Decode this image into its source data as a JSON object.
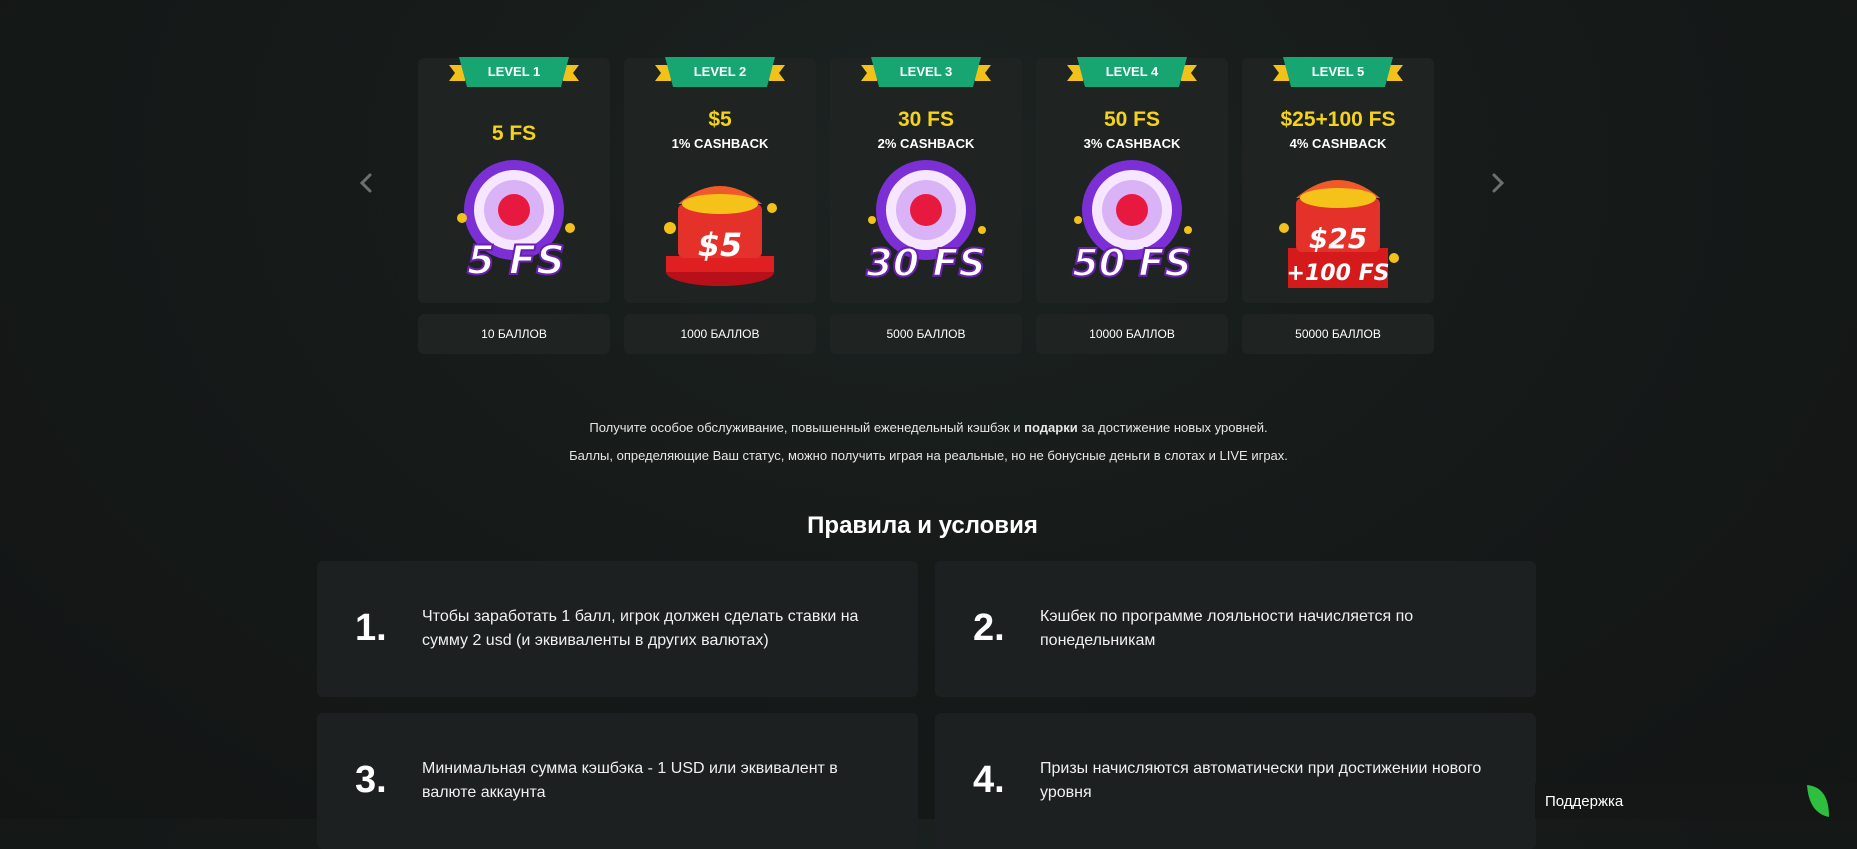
{
  "carousel": {
    "levels": [
      {
        "label": "LEVEL 1",
        "reward": "5 FS",
        "cashback": "",
        "art_text": "5 FS",
        "art": "fortune-wheel-5fs",
        "points": "10 БАЛЛОВ"
      },
      {
        "label": "LEVEL 2",
        "reward": "$5",
        "cashback": "1% CASHBACK",
        "art_text": "$5",
        "art": "treasure-chest-5",
        "points": "1000 БАЛЛОВ"
      },
      {
        "label": "LEVEL 3",
        "reward": "30 FS",
        "cashback": "2% CASHBACK",
        "art_text": "30 FS",
        "art": "fortune-wheel-30fs",
        "points": "5000 БАЛЛОВ"
      },
      {
        "label": "LEVEL 4",
        "reward": "50 FS",
        "cashback": "3% CASHBACK",
        "art_text": "50 FS",
        "art": "fortune-wheel-50fs",
        "points": "10000 БАЛЛОВ"
      },
      {
        "label": "LEVEL 5",
        "reward": "$25+100 FS",
        "cashback": "4% CASHBACK",
        "art_text": "$25",
        "art_text2": "+100 FS",
        "art": "treasure-chest-25-100fs",
        "points": "50000 БАЛЛОВ"
      }
    ]
  },
  "intro": {
    "line1_pre": "Получите особое обслуживание, повышенный еженедельный кэшбэк и ",
    "line1_bold": "подарки",
    "line1_post": " за достижение новых уровней.",
    "line2": "Баллы, определяющие Ваш статус, можно получить играя на реальные, но не бонусные деньги в слотах и LIVE играх."
  },
  "rules": {
    "title": "Правила и условия",
    "items": [
      {
        "num": "1.",
        "text": "Чтобы заработать 1 балл, игрок должен сделать ставки на сумму 2 usd (и эквиваленты в других валютах)"
      },
      {
        "num": "2.",
        "text": "Кэшбек по программе лояльности начисляется по понедельникам"
      },
      {
        "num": "3.",
        "text": "Минимальная сумма кэшбэка - 1 USD или эквивалент в валюте аккаунта"
      },
      {
        "num": "4.",
        "text": "Призы начисляются автоматически при достижении нового уровня"
      }
    ]
  },
  "support": {
    "label": "Поддержка"
  },
  "colors": {
    "accent_yellow": "#f5d21c",
    "ribbon_green": "#17a572",
    "ribbon_gold": "#f2c21a",
    "leaf_green": "#2fbf3f"
  },
  "icons": {
    "prev": "chevron-left-icon",
    "next": "chevron-right-icon",
    "support": "leaf-icon"
  }
}
